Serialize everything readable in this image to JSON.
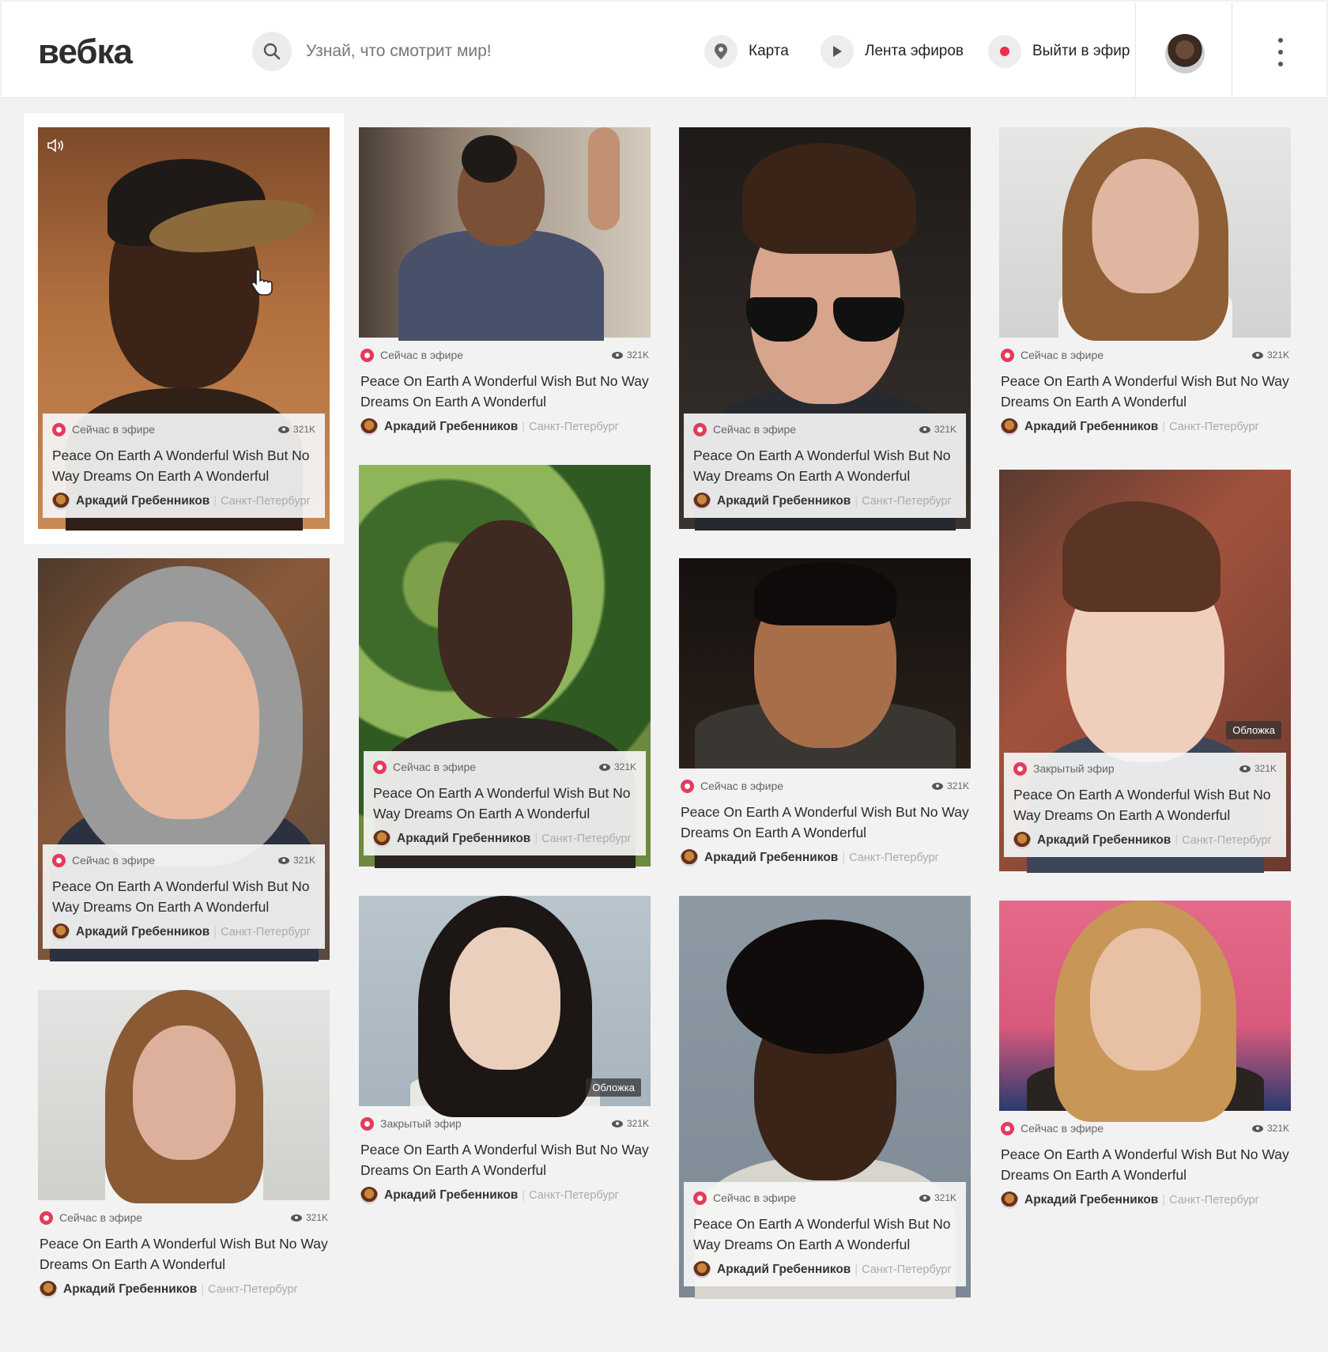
{
  "header": {
    "logo": "вебка",
    "search_placeholder": "Узнай, что смотрит мир!",
    "nav": {
      "map": "Карта",
      "feed": "Лента эфиров",
      "go_live": "Выйти в эфир"
    }
  },
  "colors": {
    "accent": "#e33b5c",
    "page_bg": "#f2f2f2"
  },
  "cards": [
    {
      "status": "Сейчас в эфире",
      "views": "321K",
      "title": "Peace On Earth A Wonderful Wish But No Way Dreams On Earth A Wonderful",
      "author": "Аркадий Гребенников",
      "city": "Санкт-Петербург"
    },
    {
      "status": "Сейчас в эфире",
      "views": "321K",
      "title": "Peace On Earth A Wonderful Wish But No Way Dreams On Earth A Wonderful",
      "author": "Аркадий Гребенников",
      "city": "Санкт-Петербург"
    },
    {
      "status": "Сейчас в эфире",
      "views": "321K",
      "title": "Peace On Earth A Wonderful Wish But No Way Dreams On Earth A Wonderful",
      "author": "Аркадий Гребенников",
      "city": "Санкт-Петербург"
    },
    {
      "status": "Сейчас в эфире",
      "views": "321K",
      "title": "Peace On Earth A Wonderful Wish But No Way Dreams On Earth A Wonderful",
      "author": "Аркадий Гребенников",
      "city": "Санкт-Петербург"
    },
    {
      "status": "Сейчас в эфире",
      "views": "321K",
      "title": "Peace On Earth A Wonderful Wish But No Way Dreams On Earth A Wonderful",
      "author": "Аркадий Гребенников",
      "city": "Санкт-Петербург"
    },
    {
      "status": "Сейчас в эфире",
      "views": "321K",
      "title": "Peace On Earth A Wonderful Wish But No Way Dreams On Earth A Wonderful",
      "author": "Аркадий Гребенников",
      "city": "Санкт-Петербург"
    },
    {
      "status": "Сейчас в эфире",
      "views": "321K",
      "title": "Peace On Earth A Wonderful Wish But No Way Dreams On Earth A Wonderful",
      "author": "Аркадий Гребенников",
      "city": "Санкт-Петербург"
    },
    {
      "status": "Закрытый эфир",
      "views": "321K",
      "title": "Peace On Earth A Wonderful Wish But No Way Dreams On Earth A Wonderful",
      "author": "Аркадий Гребенников",
      "city": "Санкт-Петербург",
      "badge": "Обложка"
    },
    {
      "status": "Сейчас в эфире",
      "views": "321K",
      "title": "Peace On Earth A Wonderful Wish But No Way Dreams On Earth A Wonderful",
      "author": "Аркадий Гребенников",
      "city": "Санкт-Петербург"
    },
    {
      "status": "Закрытый эфир",
      "views": "321K",
      "title": "Peace On Earth A Wonderful Wish But No Way Dreams On Earth A Wonderful",
      "author": "Аркадий Гребенников",
      "city": "Санкт-Петербург",
      "badge": "Обложка"
    },
    {
      "status": "Сейчас в эфире",
      "views": "321K",
      "title": "Peace On Earth A Wonderful Wish But No Way Dreams On Earth A Wonderful",
      "author": "Аркадий Гребенников",
      "city": "Санкт-Петербург"
    },
    {
      "status": "Сейчас в эфире",
      "views": "321K",
      "title": "Peace On Earth A Wonderful Wish But No Way Dreams On Earth A Wonderful",
      "author": "Аркадий Гребенников",
      "city": "Санкт-Петербург"
    }
  ]
}
